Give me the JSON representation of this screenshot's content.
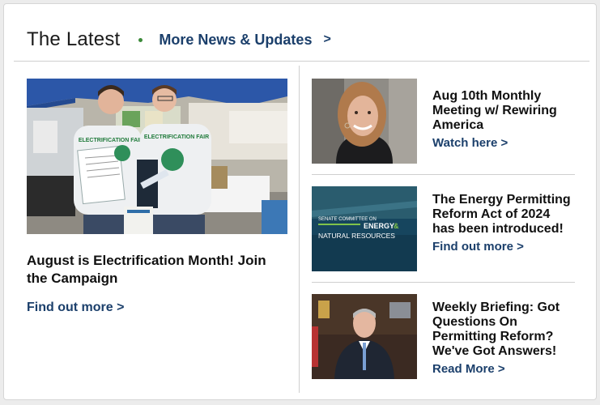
{
  "header": {
    "title": "The Latest",
    "more_link": "More News & Updates",
    "more_chevron": ">"
  },
  "featured": {
    "title": "August is Electrification Month! Join the Campaign",
    "link": "Find out more >",
    "shirt_text_left": "ELECTRIFICATION FAIR",
    "shirt_text_right": "ELECTRIFICATION FAIR"
  },
  "items": [
    {
      "title": "Aug 10th Monthly Meeting w/ Rewiring America",
      "link": "Watch here >"
    },
    {
      "title": "The Energy Permitting Reform Act of 2024 has been introduced!",
      "link": "Find out more >",
      "thumb_line1": "SENATE COMMITTEE ON",
      "thumb_line2a": "ENERGY",
      "thumb_line2b": "&",
      "thumb_line3": "NATURAL RESOURCES"
    },
    {
      "title": "Weekly Briefing: Got Questions On Permitting Reform? We've Got Answers!",
      "link": "Read More >"
    }
  ],
  "colors": {
    "link": "#1b3f6b",
    "accent_dot": "#3c8a3a",
    "tent": "#2c57a8",
    "senate_bg": "#16455e",
    "senate_green": "#7fc24a"
  }
}
